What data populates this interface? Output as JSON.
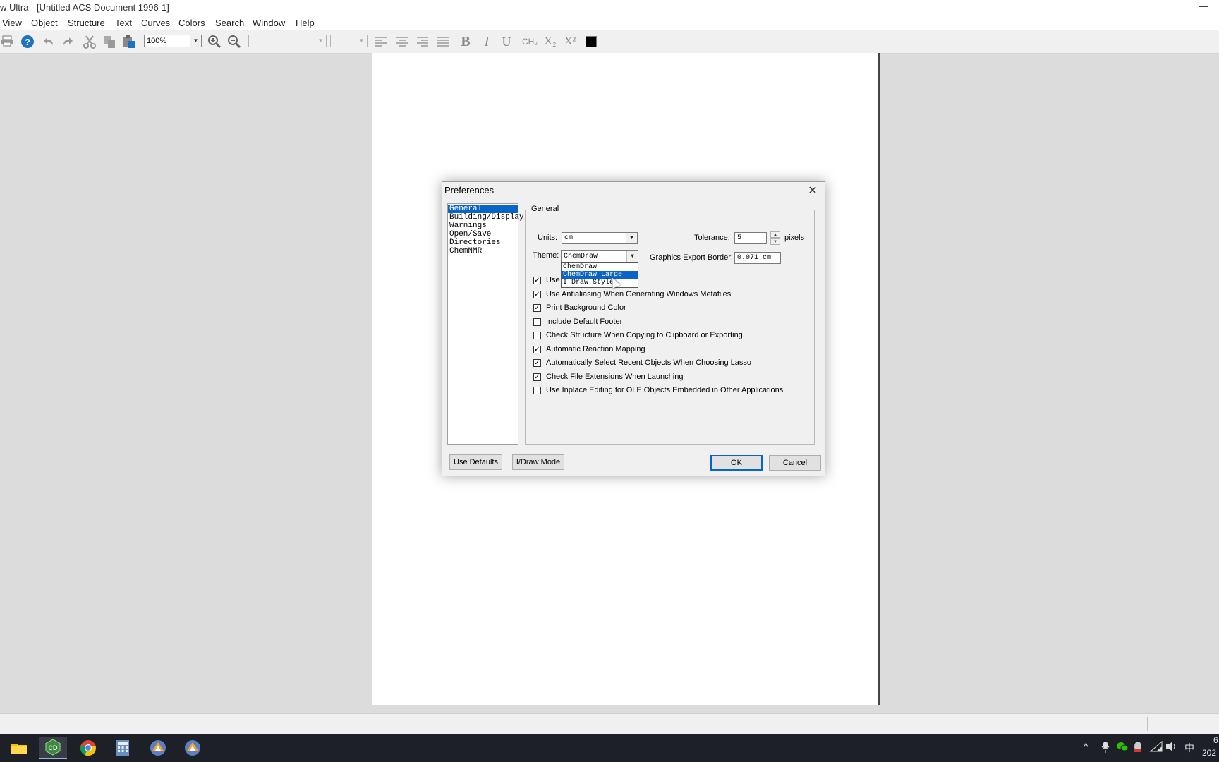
{
  "window": {
    "title": "w Ultra - [Untitled ACS Document 1996-1]",
    "minimize_glyph": "—"
  },
  "menu": [
    "View",
    "Object",
    "Structure",
    "Text",
    "Curves",
    "Colors",
    "Search",
    "Window",
    "Help"
  ],
  "toolbar": {
    "zoom_value": "100%",
    "font_value": "",
    "size_value": "",
    "icons": [
      "print-icon",
      "help-icon",
      "undo-icon",
      "redo-icon",
      "cut-icon",
      "copy-icon",
      "paste-icon",
      "zoom-in-icon",
      "zoom-out-icon",
      "align-left-icon",
      "align-center-icon",
      "align-right-icon",
      "justify-icon",
      "bold-icon",
      "italic-icon",
      "underline-icon",
      "formula-icon",
      "subscript-icon",
      "superscript-icon",
      "color-swatch"
    ],
    "bold": "B",
    "italic": "I",
    "underline": "U",
    "formula": "CH₂",
    "subscript": "X₂",
    "superscript": "X²",
    "help": "?",
    "swatch_color": "#000000"
  },
  "dialog": {
    "title": "Preferences",
    "close": "✕",
    "categories": [
      "General",
      "Building/Display",
      "Warnings",
      "Open/Save",
      "Directories",
      "ChemNMR"
    ],
    "selected_category": "General",
    "group_title": "General",
    "units_label": "Units:",
    "units_value": "cm",
    "tolerance_label": "Tolerance:",
    "tolerance_value": "5",
    "tolerance_unit": "pixels",
    "theme_label": "Theme:",
    "theme_value": "ChemDraw",
    "theme_options": [
      "ChemDraw",
      "ChemDraw Large",
      "I Draw Style"
    ],
    "theme_highlighted": "ChemDraw Large",
    "export_border_label": "Graphics Export Border:",
    "export_border_value": "0.071 cm",
    "checkboxes": [
      {
        "label": "Use",
        "checked": true
      },
      {
        "label": "Use Antialiasing When Generating Windows Metafiles",
        "checked": true
      },
      {
        "label": "Print Background Color",
        "checked": true
      },
      {
        "label": "Include Default Footer",
        "checked": false
      },
      {
        "label": "Check Structure When Copying to Clipboard or Exporting",
        "checked": false
      },
      {
        "label": "Automatic Reaction Mapping",
        "checked": true
      },
      {
        "label": "Automatically Select Recent Objects When Choosing Lasso",
        "checked": true
      },
      {
        "label": "Check File Extensions When Launching",
        "checked": true
      },
      {
        "label": "Use Inplace Editing for OLE Objects Embedded in Other Applications",
        "checked": false
      }
    ],
    "buttons": {
      "use_defaults": "Use Defaults",
      "idraw_mode": "I/Draw Mode",
      "ok": "OK",
      "cancel": "Cancel"
    }
  },
  "taskbar": {
    "apps": [
      "file-explorer-icon",
      "chemdraw-icon",
      "chrome-icon",
      "calculator-icon",
      "chemdraw-3d-icon",
      "chemdraw-3d-icon"
    ],
    "chemdraw_label": "CD",
    "tray": {
      "chevron": "^",
      "ime": "中",
      "clock_top": "6",
      "clock_bottom": "202"
    }
  },
  "colors": {
    "selection": "#0a64c8",
    "taskbar": "#1d2027"
  }
}
